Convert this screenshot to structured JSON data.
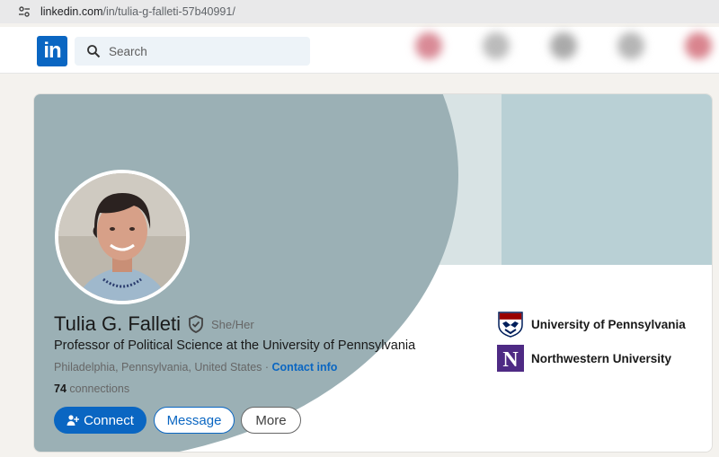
{
  "browser": {
    "url_host": "linkedin.com",
    "url_path": "/in/tulia-g-falleti-57b40991/"
  },
  "nav": {
    "logo_text": "in",
    "search_placeholder": "Search"
  },
  "profile": {
    "name": "Tulia G. Falleti",
    "pronouns": "She/Her",
    "headline": "Professor of Political Science at the University of Pennsylvania",
    "location": "Philadelphia, Pennsylvania, United States",
    "separator": " · ",
    "contact_info": "Contact info",
    "connections_count": "74",
    "connections_label": " connections"
  },
  "actions": {
    "connect": "Connect",
    "message": "Message",
    "more": "More"
  },
  "education": [
    {
      "name": "University of Pennsylvania",
      "icon": "penn-shield-icon"
    },
    {
      "name": "Northwestern University",
      "icon": "northwestern-n-icon",
      "logo_letter": "N"
    }
  ],
  "colors": {
    "linkedin_blue": "#0a66c2",
    "northwestern_purple": "#4e2a84",
    "penn_red": "#990000",
    "penn_navy": "#011f5b"
  }
}
